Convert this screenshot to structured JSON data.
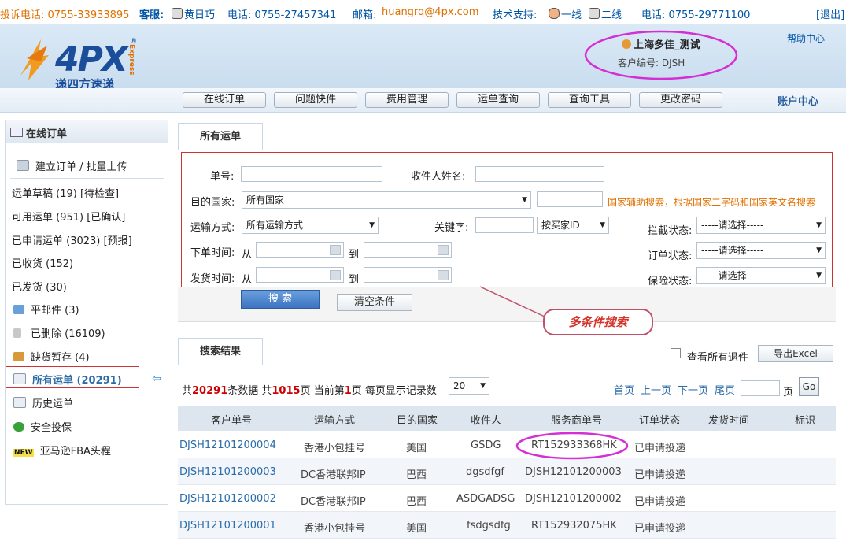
{
  "topbar": {
    "complaint": "投诉电话: 0755-33933895",
    "service_label": "客服:",
    "service_name": "黄日巧",
    "service_phone": "电话: 0755-27457341",
    "email_label": "邮箱:",
    "email": "huangrq@4px.com",
    "tech_label": "技术支持:",
    "line1": "一线",
    "line2": "二线",
    "tech_phone": "电话: 0755-29771100",
    "logout": "[退出]"
  },
  "header": {
    "logo_text": "4PX",
    "logo_cn": "递四方速递",
    "logo_express": "Express",
    "logo_reg": "®",
    "user_name": "上海多佳_测试",
    "customer_code": "客户编号:  DJSH",
    "help": "帮助中心"
  },
  "nav": {
    "items": [
      "在线订单",
      "问题快件",
      "费用管理",
      "运单查询",
      "查询工具",
      "更改密码"
    ],
    "account": "账户中心"
  },
  "sidebar": {
    "title": "在线订单",
    "create": "建立订单 / 批量上传",
    "items": [
      "运单草稿 (19) [待检查]",
      "可用运单 (951) [已确认]",
      "已申请运单 (3023) [预报]",
      "已收货 (152)",
      "已发货 (30)",
      "平邮件 (3)",
      "已删除 (16109)",
      "缺货暂存 (4)",
      "所有运单 (20291)",
      "历史运单",
      "安全投保",
      "亚马逊FBA头程"
    ],
    "new_badge": "NEW"
  },
  "search": {
    "tab": "所有运单",
    "order_no": "单号:",
    "recipient": "收件人姓名:",
    "dest_country": "目的国家:",
    "dest_value": "所有国家",
    "hint": "国家辅助搜索，根据国家二字码和国家英文名搜索",
    "ship_method": "运输方式:",
    "ship_value": "所有运输方式",
    "keyword": "关键字:",
    "keyword_type": "按买家ID",
    "intercept": "拦截状态:",
    "order_status": "订单状态:",
    "insure_status": "保险状态:",
    "please_select": "-----请选择-----",
    "order_time": "下单时间:",
    "ship_time": "发货时间:",
    "from": "从",
    "to": "到",
    "search_btn": "搜 索",
    "clear_btn": "清空条件",
    "callout": "多条件搜索"
  },
  "results": {
    "tab": "搜索结果",
    "show_returns": "查看所有退件",
    "export": "导出Excel",
    "summary_pre": "共",
    "total": "20291",
    "summary_mid1": "条数据 共",
    "pages": "1015",
    "summary_mid2": "页 当前第",
    "current": "1",
    "summary_mid3": "页 每页显示记录数",
    "per_page": "20",
    "first": "首页",
    "prev": "上一页",
    "next": "下一页",
    "last": "尾页",
    "page_unit": "页",
    "go": "Go",
    "columns": [
      "客户单号",
      "运输方式",
      "目的国家",
      "收件人",
      "服务商单号",
      "订单状态",
      "发货时间",
      "标识"
    ],
    "rows": [
      [
        "DJSH12101200004",
        "香港小包挂号",
        "美国",
        "GSDG",
        "RT152933368HK",
        "已申请投递",
        "",
        ""
      ],
      [
        "DJSH12101200003",
        "DC香港联邦IP",
        "巴西",
        "dgsdfgf",
        "DJSH12101200003",
        "已申请投递",
        "",
        ""
      ],
      [
        "DJSH12101200002",
        "DC香港联邦IP",
        "巴西",
        "ASDGADSG",
        "DJSH12101200002",
        "已申请投递",
        "",
        ""
      ],
      [
        "DJSH12101200001",
        "香港小包挂号",
        "美国",
        "fsdgsdfg",
        "RT152932075HK",
        "已申请投递",
        "",
        ""
      ]
    ]
  }
}
